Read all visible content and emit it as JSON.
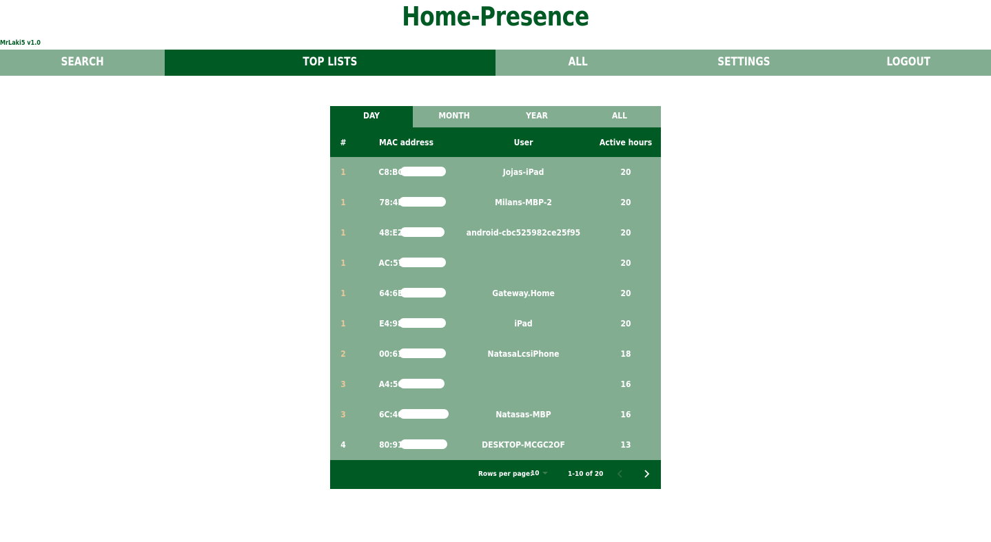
{
  "app": {
    "title": "Home-Presence",
    "version": "MrLaki5 v1.0"
  },
  "nav": {
    "items": [
      {
        "label": "SEARCH"
      },
      {
        "label": "TOP LISTS"
      },
      {
        "label": "ALL"
      },
      {
        "label": "SETTINGS"
      },
      {
        "label": "LOGOUT"
      }
    ],
    "active": "TOP LISTS"
  },
  "tabs": {
    "items": [
      {
        "label": "DAY"
      },
      {
        "label": "MONTH"
      },
      {
        "label": "YEAR"
      },
      {
        "label": "ALL"
      }
    ],
    "active": "DAY"
  },
  "table": {
    "headers": {
      "rank": "#",
      "mac": "MAC address",
      "user": "User",
      "hours": "Active hours"
    },
    "rows": [
      {
        "rank": "1",
        "mac": "C8:BC:",
        "user": "Jojas-iPad",
        "hours": "20"
      },
      {
        "rank": "1",
        "mac": "78:4F:",
        "user": "Milans-MBP-2",
        "hours": "20"
      },
      {
        "rank": "1",
        "mac": "48:E2:",
        "user": "android-cbc525982ce25f95",
        "hours": "20"
      },
      {
        "rank": "1",
        "mac": "AC:57:",
        "user": "",
        "hours": "20"
      },
      {
        "rank": "1",
        "mac": "64:6E:",
        "user": "Gateway.Home",
        "hours": "20"
      },
      {
        "rank": "1",
        "mac": "E4:98:",
        "user": "iPad",
        "hours": "20"
      },
      {
        "rank": "2",
        "mac": "00:61:",
        "user": "NatasaLcsiPhone",
        "hours": "18"
      },
      {
        "rank": "3",
        "mac": "A4:50:",
        "user": "",
        "hours": "16"
      },
      {
        "rank": "3",
        "mac": "6C:40:",
        "user": "Natasas-MBP",
        "hours": "16"
      },
      {
        "rank": "4",
        "mac": "80:91:",
        "user": "DESKTOP-MCGC2OF",
        "hours": "13"
      }
    ]
  },
  "pagination": {
    "rows_label": "Rows per page:",
    "rows_value": "10",
    "range": "1-10 of 20"
  },
  "colors": {
    "primary": "#005a24",
    "secondary": "#82ad91",
    "rank_accent": "#e8c79a"
  }
}
